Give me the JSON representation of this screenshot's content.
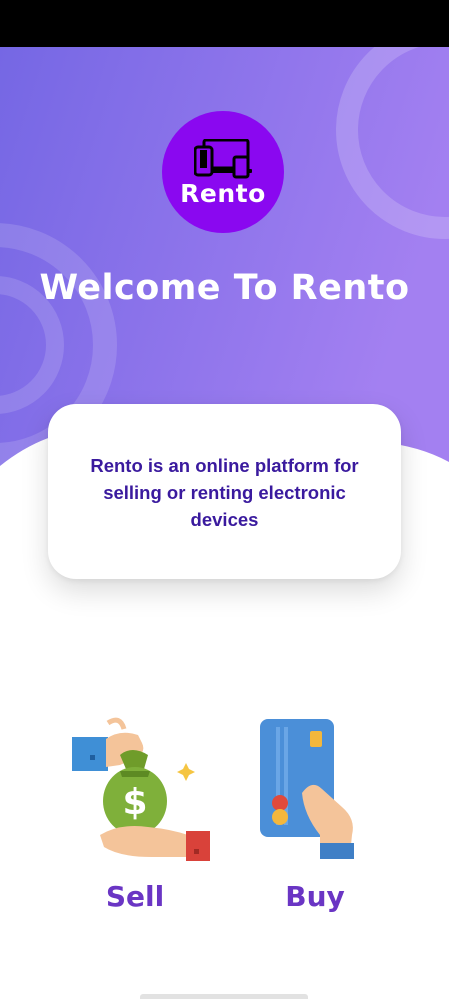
{
  "app": {
    "logo_text": "Rento",
    "welcome_title": "Welcome To Rento"
  },
  "intro_card": {
    "text": "Rento is an online platform for selling or renting electronic devices"
  },
  "options": [
    {
      "label": "Sell",
      "icon": "money-bag-handover-icon"
    },
    {
      "label": "Buy",
      "icon": "card-payment-icon"
    }
  ],
  "colors": {
    "hero_gradient_start": "#7a6ae6",
    "hero_gradient_end": "#a27df0",
    "logo_bg": "#8a08f0",
    "card_text": "#3a1a9e",
    "option_label": "#6a35c4"
  }
}
